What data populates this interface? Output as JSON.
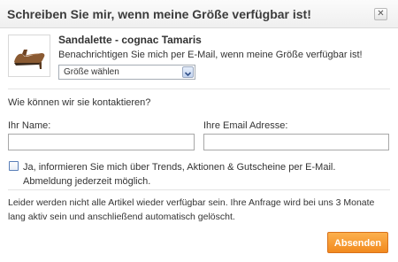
{
  "dialog": {
    "title": "Schreiben Sie mir, wenn meine Größe verfügbar ist!",
    "close_icon": "close-icon"
  },
  "product": {
    "name": "Sandalette - cognac Tamaris",
    "notify_text": "Benachrichtigen Sie mich per E-Mail, wenn meine Größe verfügbar ist!",
    "image_icon": "shoe-thumbnail",
    "image_color": "#8a5a32"
  },
  "size_select": {
    "selected": "Größe wählen"
  },
  "contact": {
    "question": "Wie können wir sie kontaktieren?",
    "name_label": "Ihr Name:",
    "name_value": "",
    "email_label": "Ihre Email Adresse:",
    "email_value": ""
  },
  "optin": {
    "checked": false,
    "text": "Ja, informieren Sie mich über Trends, Aktionen & Gutscheine per E-Mail. Abmeldung jederzeit möglich."
  },
  "disclaimer": "Leider werden nicht alle Artikel wieder verfügbar sein. Ihre Anfrage wird bei uns 3 Monate lang aktiv sein und anschließend automatisch gelöscht.",
  "submit_label": "Absenden",
  "colors": {
    "accent": "#f28a1f",
    "checkbox_border": "#5a7fb8"
  }
}
